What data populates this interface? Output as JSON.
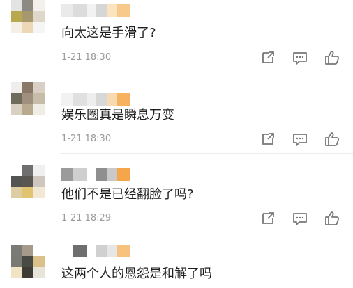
{
  "comments": [
    {
      "text": "向太这是手滑了?",
      "time": "1-21 18:30",
      "avatar": [
        "#e3e3e3",
        "#8c8a83",
        "#f4f1ec",
        "#b8a84f",
        "#a89870",
        "#dfd7c9",
        "#f6efe6",
        "#ecd8b7",
        "#f5f5f5"
      ],
      "name": [
        "#eaeaea",
        "#dcdcdc",
        "#f2f2f2",
        "#d6d6d6",
        "#fbe3c0",
        "#f7c98a"
      ]
    },
    {
      "text": "娱乐圈真是瞬息万变",
      "time": "1-21 18:30",
      "avatar": [
        "#f0eeec",
        "#8b7766",
        "#d9cfc4",
        "#6e6c5b",
        "#9f8f7c",
        "#c6bda9",
        "#d8d1c1",
        "#b9a98f",
        "#efede6"
      ],
      "name": [
        "#f2f2f2",
        "#e0e0e0",
        "#eeeeee",
        "#d8d8d8",
        "#f7d9b2",
        "#f8b25f"
      ]
    },
    {
      "text": "他们不是已经翻脸了吗?",
      "time": "1-21 18:29",
      "avatar": [
        "#ffffff",
        "#6f6f6f",
        "#efefef",
        "#545452",
        "#5a5650",
        "#cfc7bd",
        "#dccda3",
        "#e2c36f",
        "#f2e8d5"
      ],
      "name": [
        "#9b9b9b",
        "#cfcfcf",
        "#ffffff",
        "#8f8f8f",
        "#c9c9c9",
        "#f5a54a"
      ]
    },
    {
      "text": "这两个人的恩怨是和解了吗",
      "time": "",
      "avatar": [
        "#7b7b76",
        "#a69b8b",
        "#ffffff",
        "#7a7a73",
        "#4a4a44",
        "#dcc08a",
        "#f0e3c6",
        "#3e3c34",
        "#e8e4da"
      ],
      "name": [
        "#ffffff",
        "#6e6e6e",
        "#ffffff",
        "#d0d0d0",
        "#e6e6e6",
        "#f6c27e"
      ]
    }
  ],
  "icons": [
    "share-icon",
    "comment-icon",
    "like-icon"
  ]
}
